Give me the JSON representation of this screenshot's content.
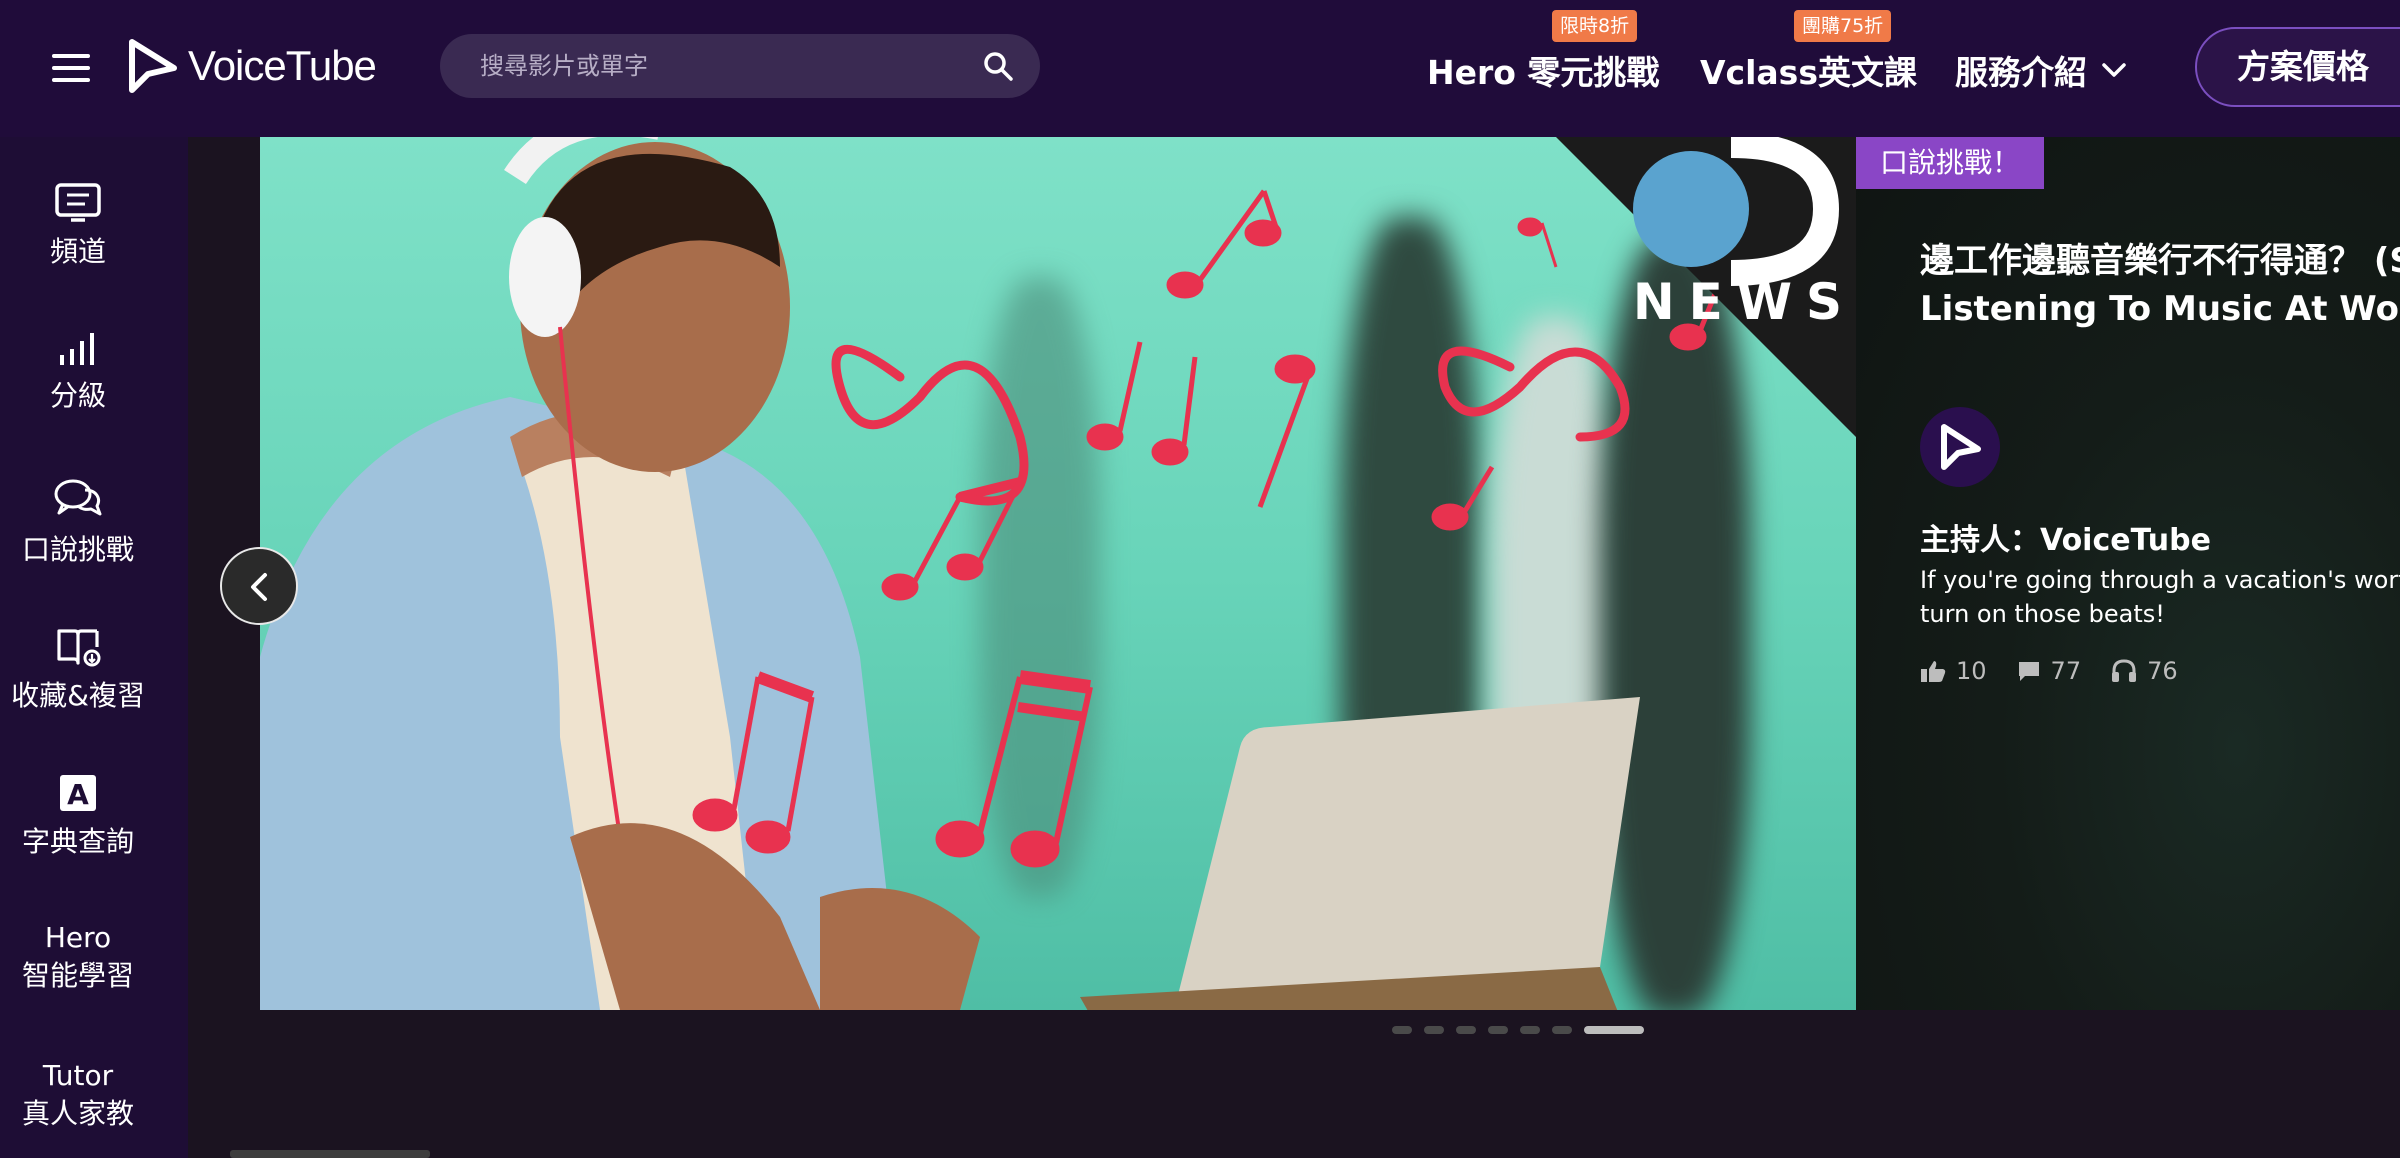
{
  "header": {
    "logo_text": "VoiceTube",
    "search_placeholder": "搜尋影片或單字",
    "nav": {
      "hero_label": "Hero 零元挑戰",
      "hero_badge": "限時8折",
      "vclass_label": "Vclass英文課",
      "vclass_badge": "團購75折",
      "services_label": "服務介紹"
    },
    "pricing_label": "方案價格"
  },
  "sidebar": {
    "items": [
      {
        "label": "頻道",
        "icon": "channel-icon"
      },
      {
        "label": "分級",
        "icon": "level-bars-icon"
      },
      {
        "label": "口說挑戰",
        "icon": "speech-bubble-icon"
      },
      {
        "label": "收藏&複習",
        "icon": "bookmark-book-icon"
      },
      {
        "label": "字典查詢",
        "icon": "dictionary-icon"
      },
      {
        "label_line1": "Hero",
        "label_line2": "智能學習"
      },
      {
        "label_line1": "Tutor",
        "label_line2": "真人家教"
      }
    ]
  },
  "banner": {
    "news_logo_text": "NEWS"
  },
  "featured": {
    "tag": "口說挑戰！",
    "title_line1": "邊工作邊聽音樂行不行得通？ (Should You Be",
    "title_line2": "Listening To Music At Work?)",
    "host": "主持人：VoiceTube",
    "desc_line1": "If you're going through a vacation's worth of email,",
    "desc_line2": "turn on those beats!",
    "likes": "10",
    "comments": "77",
    "listens": "76"
  },
  "carousel": {
    "total": 7,
    "active_index": 6
  },
  "colors": {
    "header_bg": "#200c3a",
    "sidebar_bg": "#1e0d35",
    "badge": "#f07a48",
    "tag": "#8a46c6",
    "note_red": "#e8324f"
  }
}
